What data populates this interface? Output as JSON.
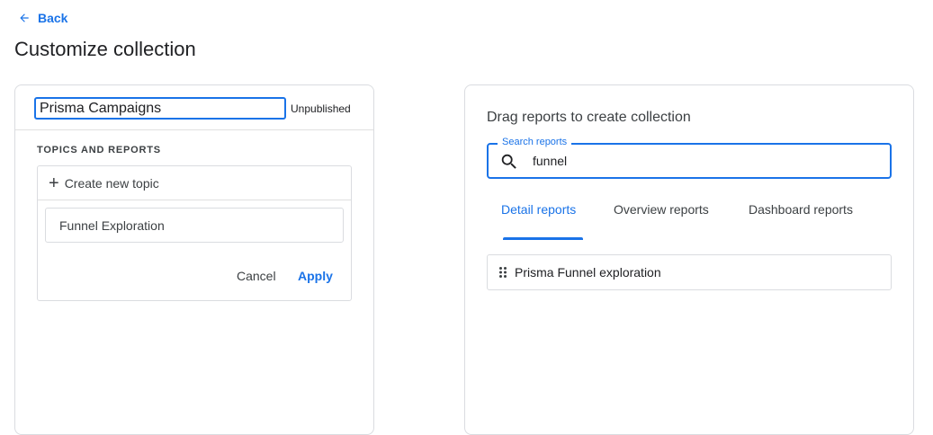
{
  "nav": {
    "back_label": "Back"
  },
  "page": {
    "title": "Customize collection"
  },
  "left_panel": {
    "collection_name": "Prisma Campaigns",
    "status": "Unpublished",
    "section_label": "TOPICS AND REPORTS",
    "create_topic_label": "Create new topic",
    "topic_name_value": "Funnel Exploration",
    "cancel_label": "Cancel",
    "apply_label": "Apply"
  },
  "right_panel": {
    "title": "Drag reports to create collection",
    "search": {
      "label": "Search reports",
      "value": "funnel"
    },
    "tabs": [
      {
        "label": "Detail reports",
        "active": true
      },
      {
        "label": "Overview reports",
        "active": false
      },
      {
        "label": "Dashboard reports",
        "active": false
      }
    ],
    "results": [
      {
        "label": "Prisma Funnel exploration"
      }
    ]
  },
  "colors": {
    "accent": "#1a73e8",
    "border": "#dadce0",
    "text": "#202124"
  }
}
